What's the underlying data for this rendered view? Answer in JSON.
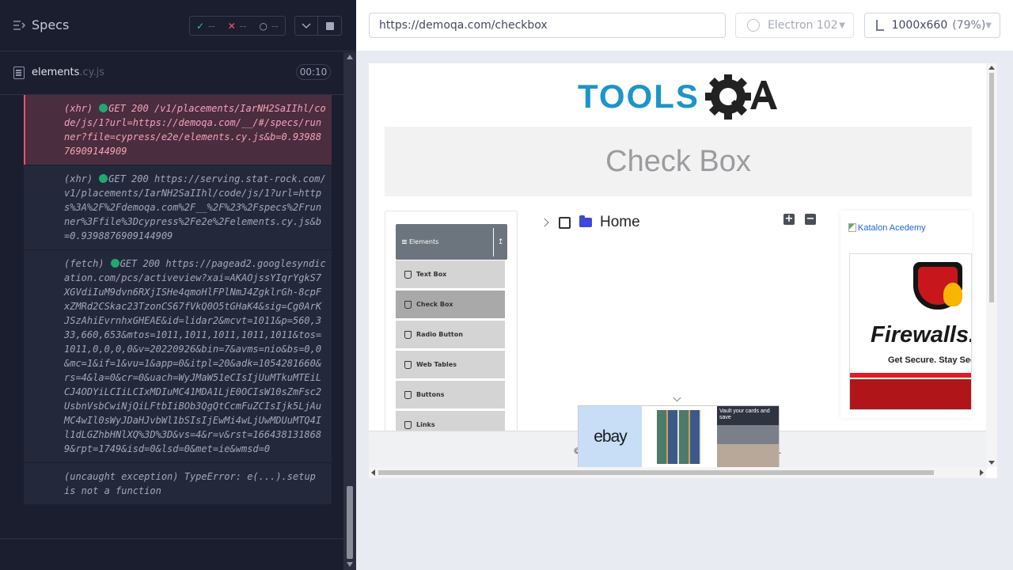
{
  "reporter": {
    "title": "Specs",
    "stats": {
      "passed_symbol": "✓",
      "failed_symbol": "✕",
      "pending_symbol": "○",
      "passed": "--",
      "failed": "--",
      "pending": "--"
    },
    "spec_file": {
      "name": "elements",
      "ext": ".cy.js",
      "duration": "00:10"
    },
    "log": [
      {
        "type": "(xhr)",
        "method_status": "GET 200",
        "text": "/v1/placements/IarNH2SaIIhl/code/js/1?url=https://demoqa.com/__/#/specs/runner?file=cypress/e2e/elements.cy.js&b=0.9398876909144909",
        "failed": true
      },
      {
        "type": "(xhr)",
        "method_status": "GET 200",
        "text": "https://serving.stat-rock.com/v1/placements/IarNH2SaIIhl/code/js/1?url=https%3A%2F%2Fdemoqa.com%2F__%2F%23%2Fspecs%2Frunner%3Ffile%3Dcypress%2Fe2e%2Felements.cy.js&b=0.9398876909144909",
        "failed": false
      },
      {
        "type": "(fetch)",
        "method_status": "GET 200",
        "text": "https://pagead2.googlesyndication.com/pcs/activeview?xai=AKAOjssYIqrYgkS7XGVdiIuM9dvn6RXjISHe4qmoHlFPlNmJ4ZgklrGh-8cpFxZMRd2CSkac23TzonCS67fVkQ0O5tGHaK4&sig=Cg0ArKJSzAhiEvrnhxGHEAE&id=lidar2&mcvt=1011&p=560,333,660,653&mtos=1011,1011,1011,1011,1011&tos=1011,0,0,0,0&v=20220926&bin=7&avms=nio&bs=0,0&mc=1&if=1&vu=1&app=0&itpl=20&adk=1054281660&rs=4&la=0&cr=0&uach=WyJMaW51eCIsIjUuMTkuMTEiLCJ4ODYiLCIiLCIxMDIuMC41MDA1LjE0OCIsW10sZmFsc2UsbnVsbCwiNjQiLFtbIiBOb3QgQtCcmFuZCIsIjk5LjAuMC4wIl0sWyJDaHJvbWl1bSIsIjEwMi4wLjUwMDUuMTQ4Il1dLGZhbHNlXQ%3D%3D&vs=4&r=v&rst=1664381318689&rpt=1749&isd=0&lsd=0&met=ie&wmsd=0",
        "failed": false
      },
      {
        "type": "(uncaught exception)",
        "method_status": "",
        "text": "TypeError: e(...).setup is not a function",
        "failed": false
      }
    ]
  },
  "browser": {
    "url": "https://demoqa.com/checkbox",
    "browser_name": "Electron 102",
    "viewport": "1000x660",
    "scale": "(79%)"
  },
  "page": {
    "logo_text": "TOOLSQA",
    "banner_title": "Check Box",
    "group_header": "Elements",
    "menu_items": [
      "Text Box",
      "Check Box",
      "Radio Button",
      "Web Tables",
      "Buttons",
      "Links"
    ],
    "active_menu_index": 1,
    "tree_root_label": "Home",
    "expand_all_symbol": "+",
    "collapse_all_symbol": "−",
    "ad_link_text": "Katalon Acedemy",
    "firewall_ad": {
      "title": "Firewalls.c",
      "tagline": "Get Secure. Stay Secur"
    },
    "footer_left": "©",
    "footer_right": ".",
    "ebay_ad": {
      "logo": "ebay",
      "promo": "Vault your cards and save"
    }
  },
  "colors": {
    "reporter_bg": "#1b1e2e",
    "failed_log_bg": "#4a2d3e",
    "pass": "#34c796",
    "fail": "#f05a7e",
    "status_dot": "#1fa971",
    "menu_active": "#a9a9aa",
    "folder": "#3d47d8"
  }
}
